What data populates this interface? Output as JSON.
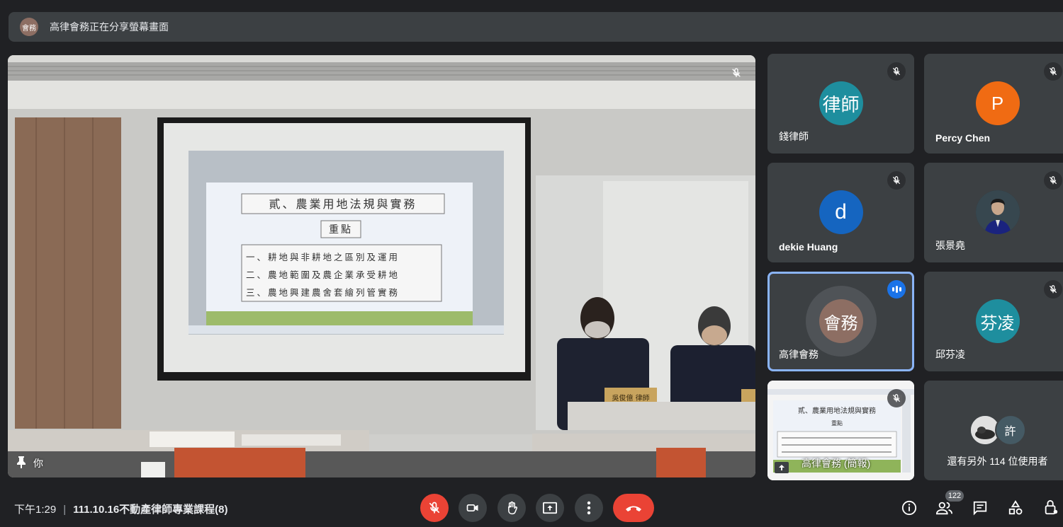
{
  "banner": {
    "avatar_text": "會務",
    "text": "高律會務正在分享螢幕畫面"
  },
  "stage": {
    "self_label": "你",
    "slide_title": "貳、農業用地法規與實務",
    "slide_subtitle": "重點",
    "slide_points": [
      "一、耕地與非耕地之區別及運用",
      "二、農地範圍及農企業承受耕地",
      "三、農地興建農舍套繪列管實務"
    ],
    "nameplate": "吳俊億 律師"
  },
  "tiles": [
    {
      "name": "錢律師",
      "avatar_text": "律師",
      "color": "#1e8e9e"
    },
    {
      "name": "Percy Chen",
      "avatar_text": "P",
      "color": "#f06b13"
    },
    {
      "name": "dekie Huang",
      "avatar_text": "d",
      "color": "#1565c0"
    },
    {
      "name": "張景堯",
      "avatar_text": "",
      "color": "#263238"
    },
    {
      "name": "高律會務",
      "avatar_text": "會務",
      "color": "#8d6e63"
    },
    {
      "name": "邱芬凌",
      "avatar_text": "芬凌",
      "color": "#1e8e9e"
    },
    {
      "name": "高律會務 (簡報)",
      "slide_title": "貳、農業用地法規與實務",
      "slide_subtitle": "重點"
    },
    {
      "others_initial": "許",
      "label": "還有另外 114 位使用者"
    }
  ],
  "footer": {
    "time": "下午1:29",
    "separator": "|",
    "meeting_title": "111.10.16不動產律師專業課程(8)",
    "participant_count": "122"
  },
  "colors": {
    "end_call": "#ea4335",
    "speaking": "#1a73e8",
    "tile_bg": "#3c4043",
    "page_bg": "#202124"
  }
}
